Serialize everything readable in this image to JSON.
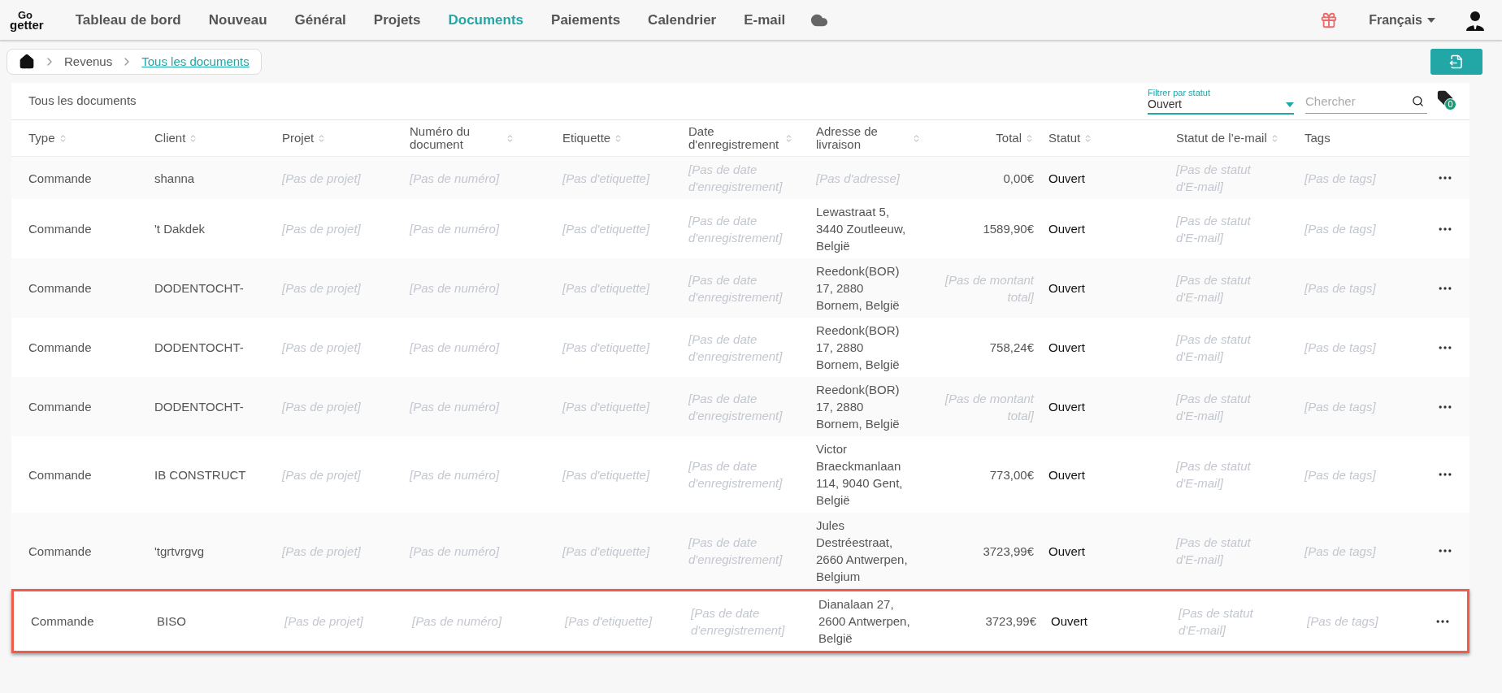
{
  "logo": {
    "top": "Go",
    "bottom": "getter"
  },
  "nav": [
    {
      "label": "Tableau de bord",
      "selected": false
    },
    {
      "label": "Nouveau",
      "selected": false
    },
    {
      "label": "Général",
      "selected": false
    },
    {
      "label": "Projets",
      "selected": false
    },
    {
      "label": "Documents",
      "selected": true
    },
    {
      "label": "Paiements",
      "selected": false
    },
    {
      "label": "Calendrier",
      "selected": false
    },
    {
      "label": "E-mail",
      "selected": false
    }
  ],
  "language": "Français",
  "breadcrumb": [
    {
      "label": "Revenus",
      "selected": false
    },
    {
      "label": "Tous les documents",
      "selected": true
    }
  ],
  "card_title": "Tous les documents",
  "status_filter": {
    "label": "Filtrer par statut",
    "value": "Ouvert"
  },
  "search": {
    "placeholder": "Chercher"
  },
  "tag_count": "0",
  "columns": [
    {
      "label": "Type",
      "sortable": true,
      "kind": "text"
    },
    {
      "label": "Client",
      "sortable": true,
      "kind": "text"
    },
    {
      "label": "Projet",
      "sortable": true,
      "kind": "text"
    },
    {
      "label": "Numéro du document",
      "sortable": true,
      "kind": "text"
    },
    {
      "label": "Etiquette",
      "sortable": true,
      "kind": "text"
    },
    {
      "label": "Date d'enregistrement",
      "sortable": true,
      "kind": "text"
    },
    {
      "label": "Adresse de livraison",
      "sortable": true,
      "kind": "text"
    },
    {
      "label": "Total",
      "sortable": true,
      "kind": "amount"
    },
    {
      "label": "Statut",
      "sortable": true,
      "kind": "text"
    },
    {
      "label": "Statut de l’e-mail",
      "sortable": true,
      "kind": "text"
    },
    {
      "label": "Tags",
      "sortable": false,
      "kind": "text"
    }
  ],
  "rows": [
    {
      "highlighted": false,
      "cells": [
        {
          "text": "Commande",
          "missing": false
        },
        {
          "text": "shanna",
          "missing": false
        },
        {
          "text": "[Pas de projet]",
          "missing": true
        },
        {
          "text": "[Pas de numéro]",
          "missing": true
        },
        {
          "text": "[Pas d'etiquette]",
          "missing": true
        },
        {
          "text": "[Pas de date d'enregistrement]",
          "missing": true
        },
        {
          "text": "[Pas d'adresse]",
          "missing": true
        },
        {
          "text": "0,00€",
          "missing": false
        },
        {
          "text": "Ouvert",
          "missing": false
        },
        {
          "text": "[Pas de statut d'E-mail]",
          "missing": true
        },
        {
          "text": "[Pas de tags]",
          "missing": true
        }
      ]
    },
    {
      "highlighted": false,
      "cells": [
        {
          "text": "Commande",
          "missing": false
        },
        {
          "text": "'t Dakdek",
          "missing": false
        },
        {
          "text": "[Pas de projet]",
          "missing": true
        },
        {
          "text": "[Pas de numéro]",
          "missing": true
        },
        {
          "text": "[Pas d'etiquette]",
          "missing": true
        },
        {
          "text": "[Pas de date d'enregistrement]",
          "missing": true
        },
        {
          "text": "Lewastraat 5, 3440 Zoutleeuw, België",
          "missing": false
        },
        {
          "text": "1589,90€",
          "missing": false
        },
        {
          "text": "Ouvert",
          "missing": false
        },
        {
          "text": "[Pas de statut d'E-mail]",
          "missing": true
        },
        {
          "text": "[Pas de tags]",
          "missing": true
        }
      ]
    },
    {
      "highlighted": false,
      "cells": [
        {
          "text": "Commande",
          "missing": false
        },
        {
          "text": "DODENTOCHT-",
          "missing": false
        },
        {
          "text": "[Pas de projet]",
          "missing": true
        },
        {
          "text": "[Pas de numéro]",
          "missing": true
        },
        {
          "text": "[Pas d'etiquette]",
          "missing": true
        },
        {
          "text": "[Pas de date d'enregistrement]",
          "missing": true
        },
        {
          "text": "Reedonk(BOR) 17, 2880 Bornem, België",
          "missing": false
        },
        {
          "text": "[Pas de montant total]",
          "missing": true
        },
        {
          "text": "Ouvert",
          "missing": false
        },
        {
          "text": "[Pas de statut d'E-mail]",
          "missing": true
        },
        {
          "text": "[Pas de tags]",
          "missing": true
        }
      ]
    },
    {
      "highlighted": false,
      "cells": [
        {
          "text": "Commande",
          "missing": false
        },
        {
          "text": "DODENTOCHT-",
          "missing": false
        },
        {
          "text": "[Pas de projet]",
          "missing": true
        },
        {
          "text": "[Pas de numéro]",
          "missing": true
        },
        {
          "text": "[Pas d'etiquette]",
          "missing": true
        },
        {
          "text": "[Pas de date d'enregistrement]",
          "missing": true
        },
        {
          "text": "Reedonk(BOR) 17, 2880 Bornem, België",
          "missing": false
        },
        {
          "text": "758,24€",
          "missing": false
        },
        {
          "text": "Ouvert",
          "missing": false
        },
        {
          "text": "[Pas de statut d'E-mail]",
          "missing": true
        },
        {
          "text": "[Pas de tags]",
          "missing": true
        }
      ]
    },
    {
      "highlighted": false,
      "cells": [
        {
          "text": "Commande",
          "missing": false
        },
        {
          "text": "DODENTOCHT-",
          "missing": false
        },
        {
          "text": "[Pas de projet]",
          "missing": true
        },
        {
          "text": "[Pas de numéro]",
          "missing": true
        },
        {
          "text": "[Pas d'etiquette]",
          "missing": true
        },
        {
          "text": "[Pas de date d'enregistrement]",
          "missing": true
        },
        {
          "text": "Reedonk(BOR) 17, 2880 Bornem, België",
          "missing": false
        },
        {
          "text": "[Pas de montant total]",
          "missing": true
        },
        {
          "text": "Ouvert",
          "missing": false
        },
        {
          "text": "[Pas de statut d'E-mail]",
          "missing": true
        },
        {
          "text": "[Pas de tags]",
          "missing": true
        }
      ]
    },
    {
      "highlighted": false,
      "cells": [
        {
          "text": "Commande",
          "missing": false
        },
        {
          "text": "IB CONSTRUCT",
          "missing": false
        },
        {
          "text": "[Pas de projet]",
          "missing": true
        },
        {
          "text": "[Pas de numéro]",
          "missing": true
        },
        {
          "text": "[Pas d'etiquette]",
          "missing": true
        },
        {
          "text": "[Pas de date d'enregistrement]",
          "missing": true
        },
        {
          "text": "Victor Braeckmanlaan 114, 9040 Gent, België",
          "missing": false
        },
        {
          "text": "773,00€",
          "missing": false
        },
        {
          "text": "Ouvert",
          "missing": false
        },
        {
          "text": "[Pas de statut d'E-mail]",
          "missing": true
        },
        {
          "text": "[Pas de tags]",
          "missing": true
        }
      ]
    },
    {
      "highlighted": false,
      "cells": [
        {
          "text": "Commande",
          "missing": false
        },
        {
          "text": "'tgrtvrgvg",
          "missing": false
        },
        {
          "text": "[Pas de projet]",
          "missing": true
        },
        {
          "text": "[Pas de numéro]",
          "missing": true
        },
        {
          "text": "[Pas d'etiquette]",
          "missing": true
        },
        {
          "text": "[Pas de date d'enregistrement]",
          "missing": true
        },
        {
          "text": "Jules Destréestraat, 2660 Antwerpen, Belgium",
          "missing": false
        },
        {
          "text": "3723,99€",
          "missing": false
        },
        {
          "text": "Ouvert",
          "missing": false
        },
        {
          "text": "[Pas de statut d'E-mail]",
          "missing": true
        },
        {
          "text": "[Pas de tags]",
          "missing": true
        }
      ]
    },
    {
      "highlighted": true,
      "cells": [
        {
          "text": "Commande",
          "missing": false
        },
        {
          "text": "BISO",
          "missing": false
        },
        {
          "text": "[Pas de projet]",
          "missing": true
        },
        {
          "text": "[Pas de numéro]",
          "missing": true
        },
        {
          "text": "[Pas d'etiquette]",
          "missing": true
        },
        {
          "text": "[Pas de date d'enregistrement]",
          "missing": true
        },
        {
          "text": "Dianalaan 27, 2600 Antwerpen, België",
          "missing": false
        },
        {
          "text": "3723,99€",
          "missing": false
        },
        {
          "text": "Ouvert",
          "missing": false
        },
        {
          "text": "[Pas de statut d'E-mail]",
          "missing": true
        },
        {
          "text": "[Pas de tags]",
          "missing": true
        }
      ]
    }
  ]
}
